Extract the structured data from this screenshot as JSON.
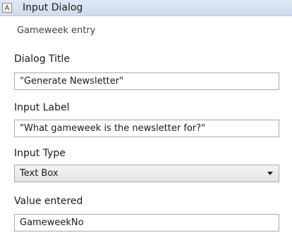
{
  "header": {
    "title": "Input Dialog",
    "icon": "text-field-icon"
  },
  "subtitle": "Gameweek entry",
  "fields": {
    "dialog_title": {
      "label": "Dialog Title",
      "value": "\"Generate Newsletter\""
    },
    "input_label": {
      "label": "Input Label",
      "value": "\"What gameweek is the newsletter for?\""
    },
    "input_type": {
      "label": "Input Type",
      "value": "Text Box"
    },
    "value_entered": {
      "label": "Value entered",
      "value": "GameweekNo"
    }
  },
  "colors": {
    "header_bg": "#cfdcec",
    "border": "#a9a9a9"
  }
}
